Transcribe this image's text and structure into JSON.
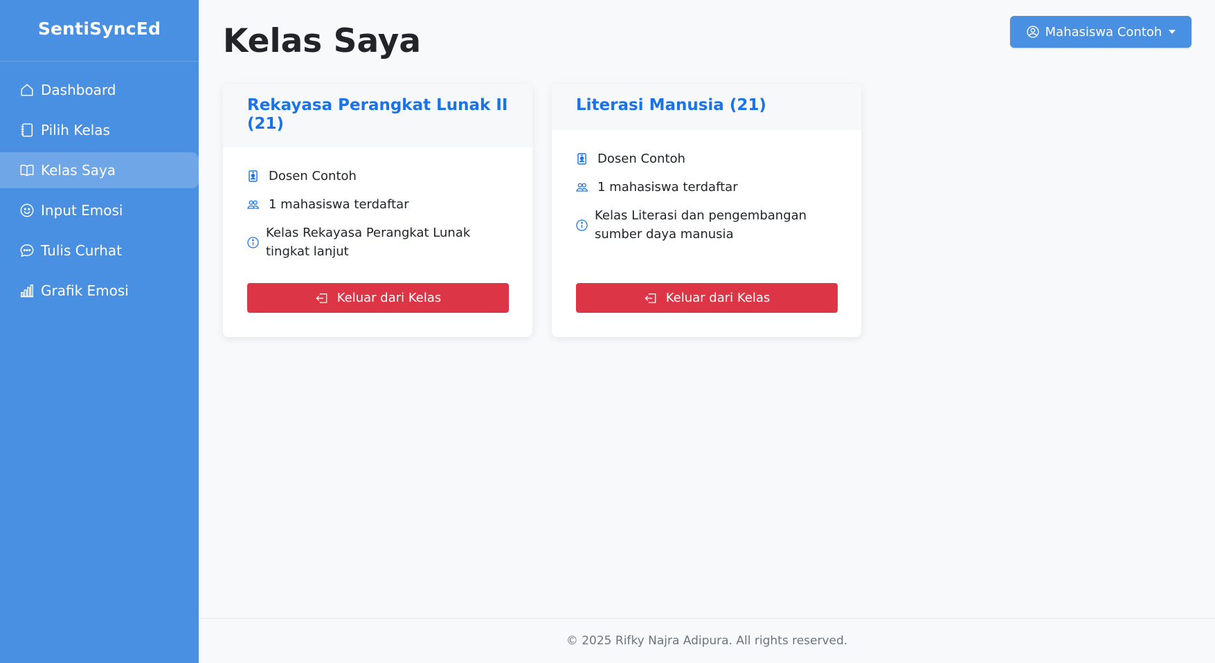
{
  "brand": "SentiSyncEd",
  "sidebar": {
    "items": [
      {
        "label": "Dashboard",
        "icon": "house-icon",
        "active": false
      },
      {
        "label": "Pilih Kelas",
        "icon": "notebook-icon",
        "active": false
      },
      {
        "label": "Kelas Saya",
        "icon": "book-icon",
        "active": true
      },
      {
        "label": "Input Emosi",
        "icon": "smile-icon",
        "active": false
      },
      {
        "label": "Tulis Curhat",
        "icon": "chat-icon",
        "active": false
      },
      {
        "label": "Grafik Emosi",
        "icon": "bar-chart-icon",
        "active": false
      }
    ]
  },
  "page_title": "Kelas Saya",
  "user_menu": {
    "label": "Mahasiswa Contoh",
    "icon": "person-circle-icon"
  },
  "cards": [
    {
      "title": "Rekayasa Perangkat Lunak II (21)",
      "lecturer": "Dosen Contoh",
      "students": "1 mahasiswa terdaftar",
      "description": "Kelas Rekayasa Perangkat Lunak tingkat lanjut",
      "button": "Keluar dari Kelas"
    },
    {
      "title": "Literasi Manusia (21)",
      "lecturer": "Dosen Contoh",
      "students": "1 mahasiswa terdaftar",
      "description": "Kelas Literasi dan pengembangan sumber daya manusia",
      "button": "Keluar dari Kelas"
    }
  ],
  "footer": "© 2025 Rifky Najra Adipura. All rights reserved.",
  "colors": {
    "sidebar": "#4a90e2",
    "accent_title": "#1a73e8",
    "danger": "#dc3545",
    "background": "#f8f9fb"
  }
}
